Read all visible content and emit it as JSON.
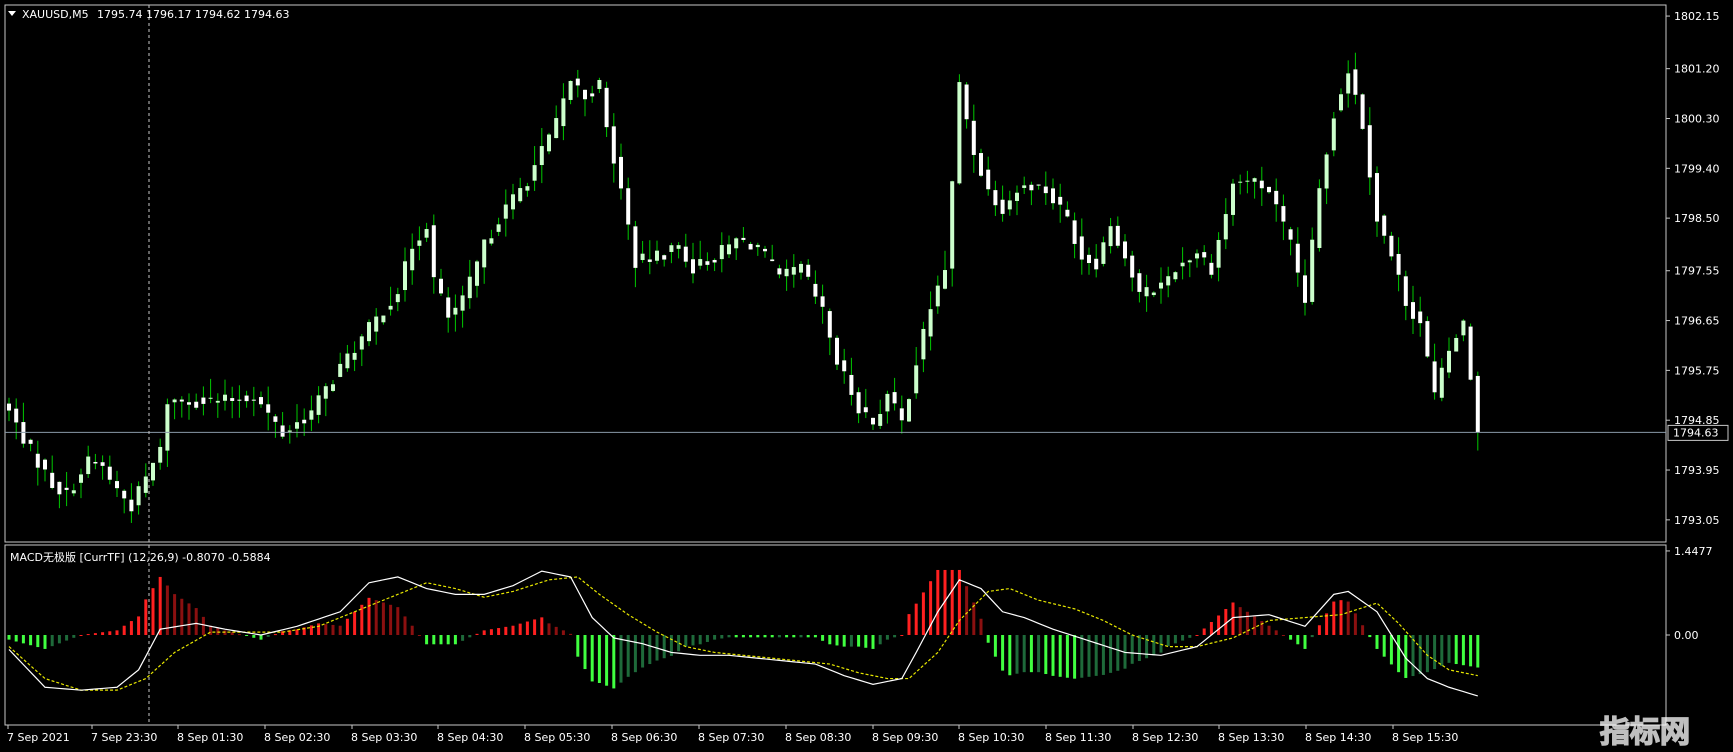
{
  "header": {
    "symbol": "XAUUSD,M5",
    "ohlc": "1795.74 1796.17 1794.62 1794.63"
  },
  "indicator": {
    "label": "MACD无极版 [CurrTF] (12,26,9) -0.8070 -0.5884"
  },
  "current_price_label": "1794.63",
  "watermark": "指标网",
  "colors": {
    "background": "#000000",
    "bull_candle": "#ccffcc",
    "bear_candle": "#ffffff",
    "wick": "#00c800",
    "frame": "#c8c8c8",
    "bid_line": "#8a9aa8",
    "hist_pos_strong": "#ff2020",
    "hist_pos_weak": "#8b1010",
    "hist_neg_strong": "#40ff40",
    "hist_neg_weak": "#1e6a3a",
    "macd_line": "#ffffff",
    "signal_line": "#e6e600"
  },
  "chart_data": [
    {
      "type": "candlestick",
      "title": "XAUUSD,M5",
      "y_ticks": [
        "1802.15",
        "1801.20",
        "1800.30",
        "1799.40",
        "1798.50",
        "1797.55",
        "1796.65",
        "1795.75",
        "1794.85",
        "1793.95",
        "1793.05"
      ],
      "ylim": [
        1792.65,
        1802.35
      ],
      "last_price": 1794.63,
      "x_ticks": [
        "7 Sep 2021",
        "7 Sep 23:30",
        "8 Sep 01:30",
        "8 Sep 02:30",
        "8 Sep 03:30",
        "8 Sep 04:30",
        "8 Sep 05:30",
        "8 Sep 06:30",
        "8 Sep 07:30",
        "8 Sep 08:30",
        "8 Sep 09:30",
        "8 Sep 10:30",
        "8 Sep 11:30",
        "8 Sep 12:30",
        "8 Sep 13:30",
        "8 Sep 14:30",
        "8 Sep 15:30"
      ],
      "anchors": [
        [
          0,
          1795.0
        ],
        [
          3,
          1794.3
        ],
        [
          6,
          1793.7
        ],
        [
          8,
          1793.5
        ],
        [
          11,
          1794.1
        ],
        [
          13,
          1794.0
        ],
        [
          15,
          1793.6
        ],
        [
          17,
          1793.3
        ],
        [
          19,
          1793.8
        ],
        [
          21,
          1794.3
        ],
        [
          22,
          1795.2
        ],
        [
          26,
          1795.2
        ],
        [
          30,
          1795.2
        ],
        [
          34,
          1795.3
        ],
        [
          38,
          1794.6
        ],
        [
          42,
          1795.0
        ],
        [
          46,
          1795.8
        ],
        [
          50,
          1796.5
        ],
        [
          54,
          1797.2
        ],
        [
          56,
          1798.0
        ],
        [
          58,
          1798.4
        ],
        [
          59,
          1797.4
        ],
        [
          61,
          1796.7
        ],
        [
          63,
          1797.0
        ],
        [
          66,
          1798.0
        ],
        [
          68,
          1798.5
        ],
        [
          72,
          1799.2
        ],
        [
          76,
          1800.2
        ],
        [
          78,
          1801.0
        ],
        [
          80,
          1800.7
        ],
        [
          82,
          1800.9
        ],
        [
          83,
          1800.1
        ],
        [
          85,
          1799.0
        ],
        [
          87,
          1797.7
        ],
        [
          90,
          1797.8
        ],
        [
          93,
          1798.0
        ],
        [
          95,
          1797.6
        ],
        [
          98,
          1797.8
        ],
        [
          101,
          1798.1
        ],
        [
          104,
          1798.0
        ],
        [
          107,
          1797.4
        ],
        [
          110,
          1797.6
        ],
        [
          113,
          1796.8
        ],
        [
          115,
          1795.9
        ],
        [
          118,
          1795.1
        ],
        [
          120,
          1794.8
        ],
        [
          122,
          1795.3
        ],
        [
          124,
          1794.8
        ],
        [
          126,
          1795.9
        ],
        [
          128,
          1796.9
        ],
        [
          130,
          1797.6
        ],
        [
          131,
          1799.1
        ],
        [
          132,
          1800.9
        ],
        [
          134,
          1799.7
        ],
        [
          136,
          1799.0
        ],
        [
          138,
          1798.7
        ],
        [
          140,
          1799.0
        ],
        [
          142,
          1799.1
        ],
        [
          144,
          1799.0
        ],
        [
          147,
          1798.5
        ],
        [
          149,
          1797.8
        ],
        [
          151,
          1797.7
        ],
        [
          153,
          1798.4
        ],
        [
          155,
          1797.8
        ],
        [
          157,
          1797.1
        ],
        [
          160,
          1797.3
        ],
        [
          162,
          1797.6
        ],
        [
          165,
          1797.9
        ],
        [
          167,
          1797.6
        ],
        [
          170,
          1799.1
        ],
        [
          172,
          1799.2
        ],
        [
          175,
          1799.0
        ],
        [
          178,
          1798.0
        ],
        [
          180,
          1797.0
        ],
        [
          182,
          1799.0
        ],
        [
          184,
          1800.4
        ],
        [
          186,
          1801.2
        ],
        [
          188,
          1800.2
        ],
        [
          190,
          1798.5
        ],
        [
          192,
          1797.8
        ],
        [
          194,
          1797.0
        ],
        [
          196,
          1796.6
        ],
        [
          198,
          1795.3
        ],
        [
          200,
          1796.1
        ],
        [
          202,
          1796.6
        ],
        [
          204,
          1794.63
        ]
      ]
    },
    {
      "type": "bar+line",
      "title": "MACD无极版 [CurrTF] (12,26,9) -0.8070 -0.5884",
      "y_ticks": [
        "1.4477",
        "0.00"
      ],
      "ylim": [
        -1.55,
        1.55
      ],
      "series": [
        {
          "name": "MACD",
          "anchors": [
            [
              0,
              -0.25
            ],
            [
              5,
              -0.9
            ],
            [
              10,
              -0.95
            ],
            [
              15,
              -0.9
            ],
            [
              18,
              -0.6
            ],
            [
              21,
              0.1
            ],
            [
              26,
              0.2
            ],
            [
              30,
              0.1
            ],
            [
              35,
              0.0
            ],
            [
              40,
              0.15
            ],
            [
              46,
              0.4
            ],
            [
              50,
              0.9
            ],
            [
              54,
              1.0
            ],
            [
              58,
              0.8
            ],
            [
              62,
              0.7
            ],
            [
              66,
              0.7
            ],
            [
              70,
              0.85
            ],
            [
              74,
              1.1
            ],
            [
              78,
              1.0
            ],
            [
              81,
              0.3
            ],
            [
              84,
              -0.05
            ],
            [
              88,
              -0.15
            ],
            [
              92,
              -0.3
            ],
            [
              96,
              -0.35
            ],
            [
              100,
              -0.35
            ],
            [
              104,
              -0.4
            ],
            [
              108,
              -0.45
            ],
            [
              112,
              -0.5
            ],
            [
              116,
              -0.7
            ],
            [
              120,
              -0.85
            ],
            [
              124,
              -0.75
            ],
            [
              126,
              -0.3
            ],
            [
              129,
              0.4
            ],
            [
              132,
              0.95
            ],
            [
              135,
              0.8
            ],
            [
              138,
              0.4
            ],
            [
              141,
              0.3
            ],
            [
              145,
              0.1
            ],
            [
              150,
              -0.1
            ],
            [
              155,
              -0.3
            ],
            [
              160,
              -0.35
            ],
            [
              165,
              -0.2
            ],
            [
              170,
              0.3
            ],
            [
              175,
              0.35
            ],
            [
              180,
              0.15
            ],
            [
              184,
              0.7
            ],
            [
              186,
              0.75
            ],
            [
              190,
              0.4
            ],
            [
              194,
              -0.4
            ],
            [
              197,
              -0.75
            ],
            [
              200,
              -0.9
            ],
            [
              204,
              -1.05
            ]
          ]
        },
        {
          "name": "Signal",
          "anchors": [
            [
              0,
              -0.2
            ],
            [
              5,
              -0.75
            ],
            [
              10,
              -0.95
            ],
            [
              15,
              -0.95
            ],
            [
              19,
              -0.75
            ],
            [
              23,
              -0.3
            ],
            [
              28,
              0.05
            ],
            [
              33,
              0.05
            ],
            [
              38,
              0.05
            ],
            [
              43,
              0.15
            ],
            [
              48,
              0.4
            ],
            [
              53,
              0.65
            ],
            [
              58,
              0.9
            ],
            [
              62,
              0.8
            ],
            [
              66,
              0.65
            ],
            [
              70,
              0.75
            ],
            [
              75,
              0.95
            ],
            [
              79,
              1.0
            ],
            [
              82,
              0.7
            ],
            [
              86,
              0.35
            ],
            [
              90,
              0.05
            ],
            [
              94,
              -0.2
            ],
            [
              98,
              -0.3
            ],
            [
              102,
              -0.35
            ],
            [
              106,
              -0.4
            ],
            [
              110,
              -0.45
            ],
            [
              114,
              -0.5
            ],
            [
              118,
              -0.65
            ],
            [
              122,
              -0.75
            ],
            [
              125,
              -0.75
            ],
            [
              129,
              -0.3
            ],
            [
              132,
              0.25
            ],
            [
              136,
              0.75
            ],
            [
              139,
              0.8
            ],
            [
              143,
              0.6
            ],
            [
              148,
              0.45
            ],
            [
              152,
              0.25
            ],
            [
              156,
              0.0
            ],
            [
              161,
              -0.2
            ],
            [
              165,
              -0.2
            ],
            [
              170,
              -0.05
            ],
            [
              175,
              0.25
            ],
            [
              180,
              0.3
            ],
            [
              185,
              0.35
            ],
            [
              190,
              0.55
            ],
            [
              193,
              0.2
            ],
            [
              197,
              -0.35
            ],
            [
              200,
              -0.6
            ],
            [
              204,
              -0.7
            ]
          ]
        }
      ]
    }
  ]
}
